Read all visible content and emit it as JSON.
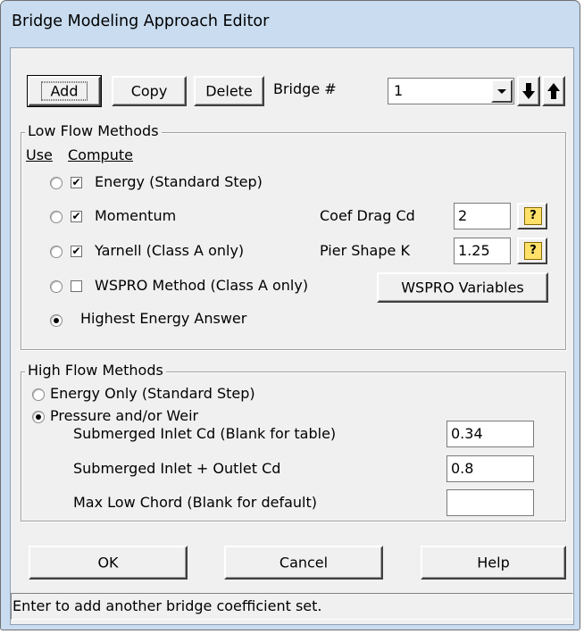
{
  "window": {
    "title": "Bridge Modeling Approach Editor"
  },
  "toolbar": {
    "add_label": "Add",
    "copy_label": "Copy",
    "delete_label": "Delete",
    "bridge_label": "Bridge #",
    "bridge_value": "1",
    "down_icon": "arrow-down-icon",
    "up_icon": "arrow-up-icon"
  },
  "low_flow": {
    "title": "Low Flow Methods",
    "use_header": "Use",
    "compute_header": "Compute",
    "methods": [
      {
        "label": "Energy (Standard Step)",
        "use_selected": false,
        "compute_checked": true
      },
      {
        "label": "Momentum",
        "use_selected": false,
        "compute_checked": true
      },
      {
        "label": "Yarnell (Class A only)",
        "use_selected": false,
        "compute_checked": true
      },
      {
        "label": "WSPRO Method (Class A only)",
        "use_selected": false,
        "compute_checked": false
      }
    ],
    "highest_energy_label": "Highest Energy Answer",
    "highest_energy_selected": true,
    "coef_drag_label": "Coef Drag Cd",
    "coef_drag_value": "2",
    "pier_shape_label": "Pier Shape K",
    "pier_shape_value": "1.25",
    "wspro_button_label": "WSPRO Variables",
    "help_icon_glyph": "?"
  },
  "high_flow": {
    "title": "High Flow Methods",
    "energy_only_label": "Energy Only (Standard Step)",
    "energy_only_selected": false,
    "pressure_weir_label": "Pressure and/or Weir",
    "pressure_weir_selected": true,
    "submerged_inlet_label": "Submerged Inlet Cd (Blank for table)",
    "submerged_inlet_value": "0.34",
    "submerged_inlet_outlet_label": "Submerged Inlet + Outlet Cd",
    "submerged_inlet_outlet_value": "0.8",
    "max_low_chord_label": "Max Low Chord (Blank for default)",
    "max_low_chord_value": ""
  },
  "footer": {
    "ok_label": "OK",
    "cancel_label": "Cancel",
    "help_label": "Help"
  },
  "status_text": "Enter to add another bridge coefficient set."
}
